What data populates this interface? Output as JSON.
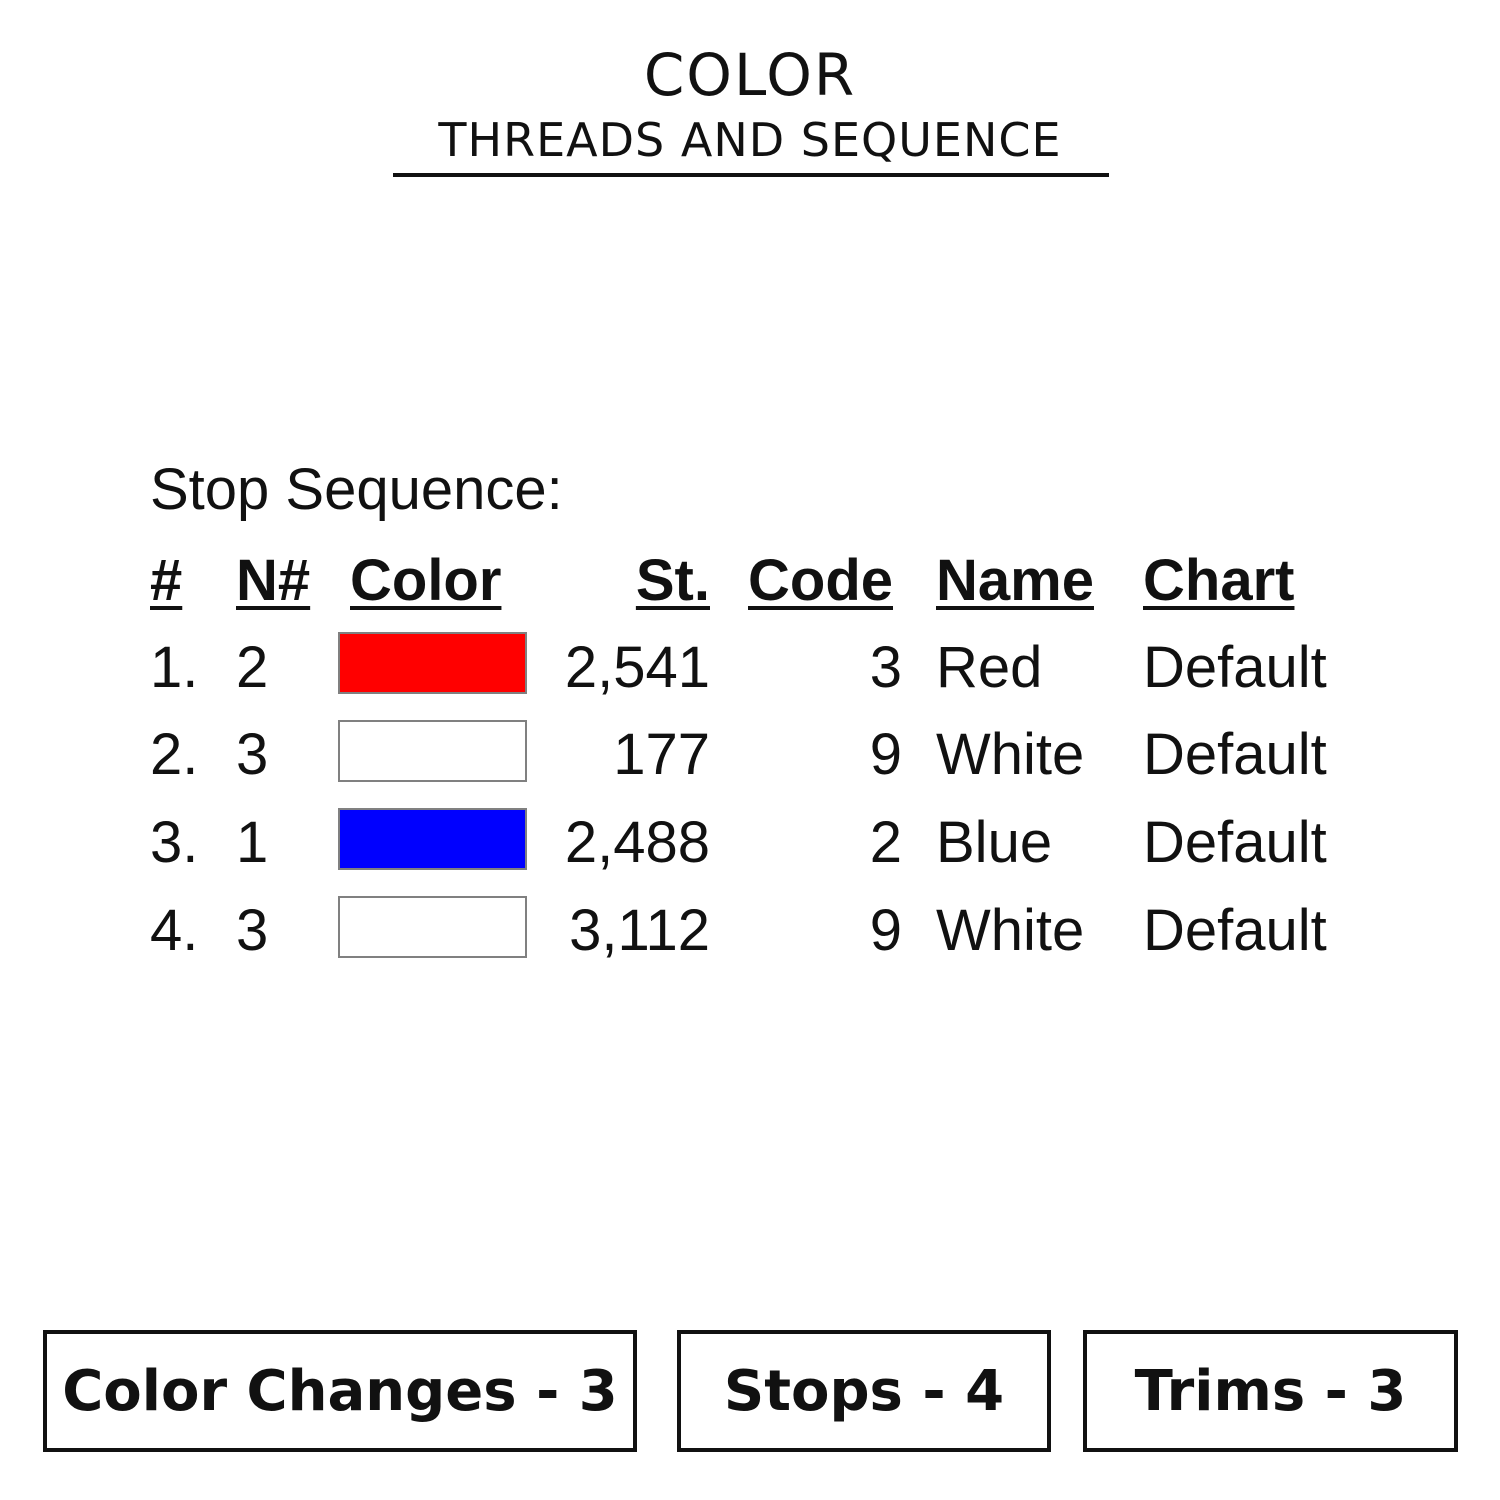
{
  "header": {
    "title": "COLOR",
    "subtitle": "THREADS AND SEQUENCE"
  },
  "stop_sequence": {
    "heading": "Stop Sequence:",
    "columns": [
      "#",
      "N#",
      "Color",
      "St.",
      "Code",
      "Name",
      "Chart"
    ],
    "rows": [
      {
        "index": "1.",
        "needle": "2",
        "color_hex": "#ff0000",
        "stitches": "2,541",
        "code": "3",
        "name": "Red",
        "chart": "Default"
      },
      {
        "index": "2.",
        "needle": "3",
        "color_hex": "#ffffff",
        "stitches": "177",
        "code": "9",
        "name": "White",
        "chart": "Default"
      },
      {
        "index": "3.",
        "needle": "1",
        "color_hex": "#0000ff",
        "stitches": "2,488",
        "code": "2",
        "name": "Blue",
        "chart": "Default"
      },
      {
        "index": "4.",
        "needle": "3",
        "color_hex": "#ffffff",
        "stitches": "3,112",
        "code": "9",
        "name": "White",
        "chart": "Default"
      }
    ]
  },
  "summary": {
    "color_changes": "Color Changes - 3",
    "stops": "Stops - 4",
    "trims": "Trims - 3"
  }
}
